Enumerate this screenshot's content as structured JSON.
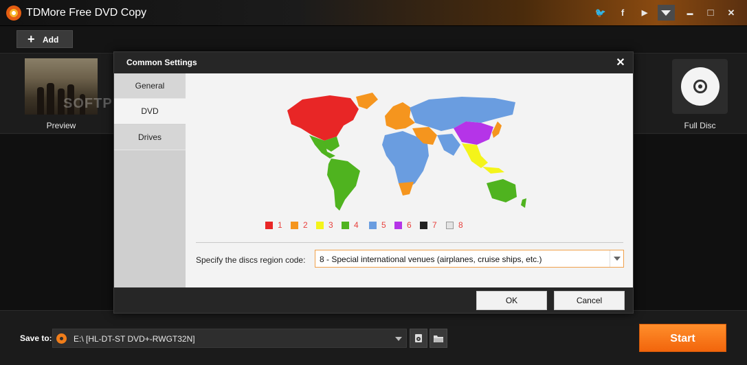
{
  "app": {
    "title": "TDMore Free DVD Copy"
  },
  "titlebar": {
    "icons": [
      "twitter-icon",
      "facebook-icon",
      "youtube-icon",
      "menu-dropdown-icon",
      "minimize-icon",
      "maximize-icon",
      "close-icon"
    ],
    "twitter_glyph": "🐦",
    "facebook_glyph": "f",
    "youtube_glyph": "▶",
    "minimize_glyph": "▬",
    "maximize_glyph": "□",
    "close_glyph": "✕"
  },
  "toolbar": {
    "add_label": "Add",
    "add_icon": "plus-icon"
  },
  "content": {
    "preview_label": "Preview",
    "full_disc_label": "Full Disc",
    "watermark": "SOFTPEDIA"
  },
  "bottom": {
    "save_to_label": "Save to:",
    "save_to_value": "E:\\ [HL-DT-ST DVD+-RWGT32N]",
    "start_label": "Start"
  },
  "dialog": {
    "title": "Common Settings",
    "close_glyph": "✕",
    "tabs": [
      "General",
      "DVD",
      "Drives"
    ],
    "active_tab": "DVD",
    "region_legend": [
      {
        "label": "1",
        "color": "#e82626"
      },
      {
        "label": "2",
        "color": "#f5951e"
      },
      {
        "label": "3",
        "color": "#f4f41a"
      },
      {
        "label": "4",
        "color": "#4fb31f"
      },
      {
        "label": "5",
        "color": "#6a9de0"
      },
      {
        "label": "6",
        "color": "#b534e8"
      },
      {
        "label": "7",
        "color": "#222222"
      },
      {
        "label": "8",
        "color": "#e3e3e3"
      }
    ],
    "region_label": "Specify the discs region code:",
    "region_value": "8 - Special international venues (airplanes, cruise ships, etc.)",
    "ok_label": "OK",
    "cancel_label": "Cancel"
  },
  "colors": {
    "accent": "#f2650c",
    "region_border": "#f0a04a"
  }
}
